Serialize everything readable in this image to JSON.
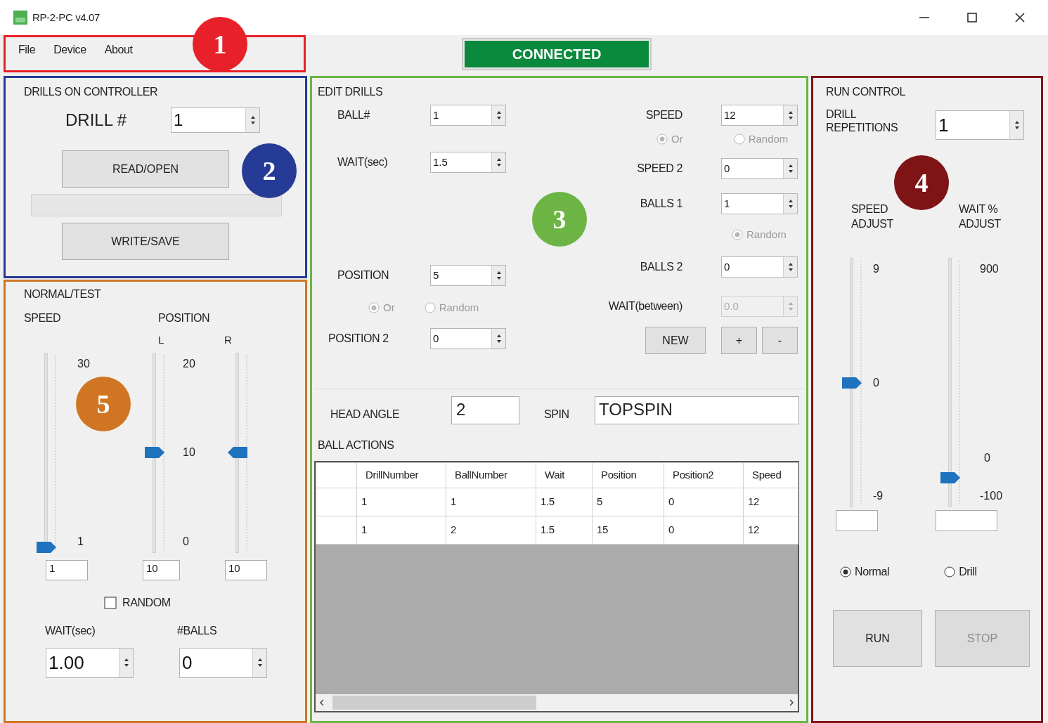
{
  "window": {
    "title": "RP-2-PC v4.07"
  },
  "menu_bar": {
    "items": [
      "File",
      "Device",
      "About"
    ],
    "annotation": {
      "number": "1",
      "color": "#e8202a"
    }
  },
  "connection_status": "CONNECTED",
  "drills_on_controller": {
    "title": "DRILLS ON CONTROLLER",
    "drill_label": "DRILL #",
    "drill_value": "1",
    "buttons": [
      "READ/OPEN",
      "WRITE/SAVE"
    ],
    "progress": {
      "level": 0
    },
    "annotation": {
      "number": "2",
      "color": "#253b95"
    }
  },
  "normal_test": {
    "title": "NORMAL/TEST",
    "speed_label": "SPEED",
    "position_label": "POSITION",
    "speed_slider": {
      "max_label": "30",
      "min_label": "1",
      "level": 0,
      "value": "1"
    },
    "position_sliders": {
      "left_label": "L",
      "right_label": "R",
      "scale_labels": [
        "20",
        "10",
        "0"
      ],
      "left": {
        "level": 0.5,
        "value": "10"
      },
      "right": {
        "level": 0.5,
        "value": "10"
      }
    },
    "random_checkbox": {
      "label": "RANDOM",
      "checked": false
    },
    "wait": {
      "label": "WAIT(sec)",
      "value": "1.00"
    },
    "balls": {
      "label": "#BALLS",
      "value": "0"
    },
    "annotation": {
      "number": "5",
      "color": "#d07622"
    }
  },
  "edit_drills": {
    "title": "EDIT DRILLS",
    "ball_number": {
      "label": "BALL#",
      "value": "1"
    },
    "wait": {
      "label": "WAIT(sec)",
      "value": "1.5"
    },
    "position": {
      "label": "POSITION",
      "value": "5"
    },
    "position_mode": [
      {
        "label": "Or",
        "selected": true,
        "disabled": true
      },
      {
        "label": "Random",
        "selected": false,
        "disabled": true
      }
    ],
    "position_2": {
      "label": "POSITION 2",
      "value": "0"
    },
    "speed": {
      "label": "SPEED",
      "value": "12"
    },
    "speed_mode": [
      {
        "label": "Or",
        "selected": true,
        "disabled": true
      },
      {
        "label": "Random",
        "selected": false,
        "disabled": true
      }
    ],
    "speed_2": {
      "label": "SPEED 2",
      "value": "0"
    },
    "balls_1": {
      "label": "BALLS 1",
      "value": "1"
    },
    "balls_mode": [
      {
        "label": "Random",
        "selected": true,
        "disabled": true
      }
    ],
    "balls_2": {
      "label": "BALLS 2",
      "value": "0"
    },
    "wait_between": {
      "label": "WAIT(between)",
      "value": "0.0",
      "disabled": true
    },
    "buttons": [
      "NEW",
      "+",
      "-"
    ],
    "head_angle": {
      "label": "HEAD ANGLE",
      "value": "2"
    },
    "spin": {
      "label": "SPIN",
      "value": "TOPSPIN"
    },
    "ball_actions": {
      "title": "BALL ACTIONS",
      "table": {
        "columns": [
          "DrillNumber",
          "BallNumber",
          "Wait",
          "Position",
          "Position2",
          "Speed"
        ],
        "rows": [
          [
            "1",
            "1",
            "1.5",
            "5",
            "0",
            "12"
          ],
          [
            "1",
            "2",
            "1.5",
            "15",
            "0",
            "12"
          ]
        ]
      }
    },
    "annotation": {
      "number": "3",
      "color": "#6cb444"
    }
  },
  "run_control": {
    "title": "RUN CONTROL",
    "repetitions": {
      "label": "DRILL REPETITIONS",
      "value": "1"
    },
    "sliders": [
      {
        "label": "SPEED ADJUST",
        "max_label": "9",
        "mid_label": "0",
        "min_label": "-9",
        "level": 0.5
      },
      {
        "label": "WAIT % ADJUST",
        "max_label": "900",
        "mid_label": "0",
        "min_label": "-100",
        "level": 0.1
      }
    ],
    "mode": [
      {
        "label": "Normal",
        "selected": true
      },
      {
        "label": "Drill",
        "selected": false
      }
    ],
    "buttons": [
      {
        "label": "RUN",
        "disabled": false
      },
      {
        "label": "STOP",
        "disabled": true
      }
    ],
    "annotation": {
      "number": "4",
      "color": "#7f1416"
    }
  }
}
